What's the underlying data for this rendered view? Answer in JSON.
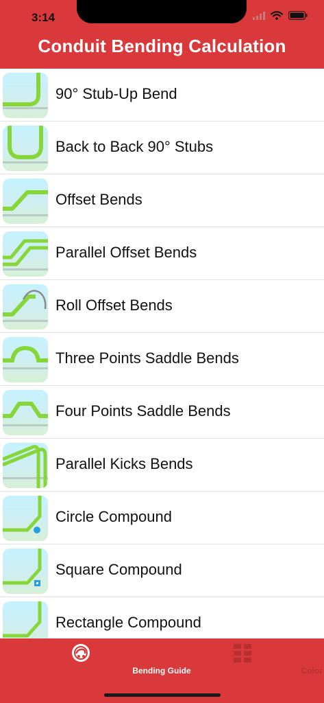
{
  "status_bar": {
    "time": "3:14"
  },
  "header": {
    "title": "Conduit Bending Calculation"
  },
  "list": {
    "items": [
      {
        "label": "90° Stub-Up Bend"
      },
      {
        "label": "Back to Back 90° Stubs"
      },
      {
        "label": "Offset Bends"
      },
      {
        "label": "Parallel Offset Bends"
      },
      {
        "label": "Roll Offset Bends"
      },
      {
        "label": "Three Points Saddle Bends"
      },
      {
        "label": "Four Points Saddle Bends"
      },
      {
        "label": "Parallel Kicks Bends"
      },
      {
        "label": "Circle Compound"
      },
      {
        "label": "Square Compound"
      },
      {
        "label": "Rectangle Compound"
      }
    ]
  },
  "tab_bar": {
    "tabs": [
      {
        "label": "Bending Guide",
        "icon": "bender-logo-icon",
        "selected": true
      },
      {
        "label": "Color Code",
        "icon": "grid-icon",
        "selected": false
      }
    ]
  },
  "colors": {
    "header_bg": "#d9393a",
    "conduit_green": "#86d63a",
    "marker_blue": "#2a9fe0"
  }
}
